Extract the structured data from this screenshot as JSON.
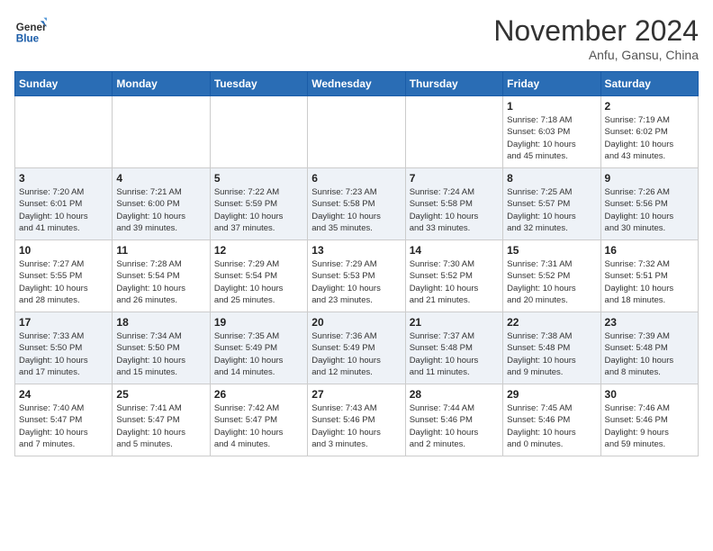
{
  "header": {
    "logo_general": "General",
    "logo_blue": "Blue",
    "month": "November 2024",
    "location": "Anfu, Gansu, China"
  },
  "weekdays": [
    "Sunday",
    "Monday",
    "Tuesday",
    "Wednesday",
    "Thursday",
    "Friday",
    "Saturday"
  ],
  "weeks": [
    [
      {
        "day": "",
        "info": ""
      },
      {
        "day": "",
        "info": ""
      },
      {
        "day": "",
        "info": ""
      },
      {
        "day": "",
        "info": ""
      },
      {
        "day": "",
        "info": ""
      },
      {
        "day": "1",
        "info": "Sunrise: 7:18 AM\nSunset: 6:03 PM\nDaylight: 10 hours\nand 45 minutes."
      },
      {
        "day": "2",
        "info": "Sunrise: 7:19 AM\nSunset: 6:02 PM\nDaylight: 10 hours\nand 43 minutes."
      }
    ],
    [
      {
        "day": "3",
        "info": "Sunrise: 7:20 AM\nSunset: 6:01 PM\nDaylight: 10 hours\nand 41 minutes."
      },
      {
        "day": "4",
        "info": "Sunrise: 7:21 AM\nSunset: 6:00 PM\nDaylight: 10 hours\nand 39 minutes."
      },
      {
        "day": "5",
        "info": "Sunrise: 7:22 AM\nSunset: 5:59 PM\nDaylight: 10 hours\nand 37 minutes."
      },
      {
        "day": "6",
        "info": "Sunrise: 7:23 AM\nSunset: 5:58 PM\nDaylight: 10 hours\nand 35 minutes."
      },
      {
        "day": "7",
        "info": "Sunrise: 7:24 AM\nSunset: 5:58 PM\nDaylight: 10 hours\nand 33 minutes."
      },
      {
        "day": "8",
        "info": "Sunrise: 7:25 AM\nSunset: 5:57 PM\nDaylight: 10 hours\nand 32 minutes."
      },
      {
        "day": "9",
        "info": "Sunrise: 7:26 AM\nSunset: 5:56 PM\nDaylight: 10 hours\nand 30 minutes."
      }
    ],
    [
      {
        "day": "10",
        "info": "Sunrise: 7:27 AM\nSunset: 5:55 PM\nDaylight: 10 hours\nand 28 minutes."
      },
      {
        "day": "11",
        "info": "Sunrise: 7:28 AM\nSunset: 5:54 PM\nDaylight: 10 hours\nand 26 minutes."
      },
      {
        "day": "12",
        "info": "Sunrise: 7:29 AM\nSunset: 5:54 PM\nDaylight: 10 hours\nand 25 minutes."
      },
      {
        "day": "13",
        "info": "Sunrise: 7:29 AM\nSunset: 5:53 PM\nDaylight: 10 hours\nand 23 minutes."
      },
      {
        "day": "14",
        "info": "Sunrise: 7:30 AM\nSunset: 5:52 PM\nDaylight: 10 hours\nand 21 minutes."
      },
      {
        "day": "15",
        "info": "Sunrise: 7:31 AM\nSunset: 5:52 PM\nDaylight: 10 hours\nand 20 minutes."
      },
      {
        "day": "16",
        "info": "Sunrise: 7:32 AM\nSunset: 5:51 PM\nDaylight: 10 hours\nand 18 minutes."
      }
    ],
    [
      {
        "day": "17",
        "info": "Sunrise: 7:33 AM\nSunset: 5:50 PM\nDaylight: 10 hours\nand 17 minutes."
      },
      {
        "day": "18",
        "info": "Sunrise: 7:34 AM\nSunset: 5:50 PM\nDaylight: 10 hours\nand 15 minutes."
      },
      {
        "day": "19",
        "info": "Sunrise: 7:35 AM\nSunset: 5:49 PM\nDaylight: 10 hours\nand 14 minutes."
      },
      {
        "day": "20",
        "info": "Sunrise: 7:36 AM\nSunset: 5:49 PM\nDaylight: 10 hours\nand 12 minutes."
      },
      {
        "day": "21",
        "info": "Sunrise: 7:37 AM\nSunset: 5:48 PM\nDaylight: 10 hours\nand 11 minutes."
      },
      {
        "day": "22",
        "info": "Sunrise: 7:38 AM\nSunset: 5:48 PM\nDaylight: 10 hours\nand 9 minutes."
      },
      {
        "day": "23",
        "info": "Sunrise: 7:39 AM\nSunset: 5:48 PM\nDaylight: 10 hours\nand 8 minutes."
      }
    ],
    [
      {
        "day": "24",
        "info": "Sunrise: 7:40 AM\nSunset: 5:47 PM\nDaylight: 10 hours\nand 7 minutes."
      },
      {
        "day": "25",
        "info": "Sunrise: 7:41 AM\nSunset: 5:47 PM\nDaylight: 10 hours\nand 5 minutes."
      },
      {
        "day": "26",
        "info": "Sunrise: 7:42 AM\nSunset: 5:47 PM\nDaylight: 10 hours\nand 4 minutes."
      },
      {
        "day": "27",
        "info": "Sunrise: 7:43 AM\nSunset: 5:46 PM\nDaylight: 10 hours\nand 3 minutes."
      },
      {
        "day": "28",
        "info": "Sunrise: 7:44 AM\nSunset: 5:46 PM\nDaylight: 10 hours\nand 2 minutes."
      },
      {
        "day": "29",
        "info": "Sunrise: 7:45 AM\nSunset: 5:46 PM\nDaylight: 10 hours\nand 0 minutes."
      },
      {
        "day": "30",
        "info": "Sunrise: 7:46 AM\nSunset: 5:46 PM\nDaylight: 9 hours\nand 59 minutes."
      }
    ]
  ]
}
